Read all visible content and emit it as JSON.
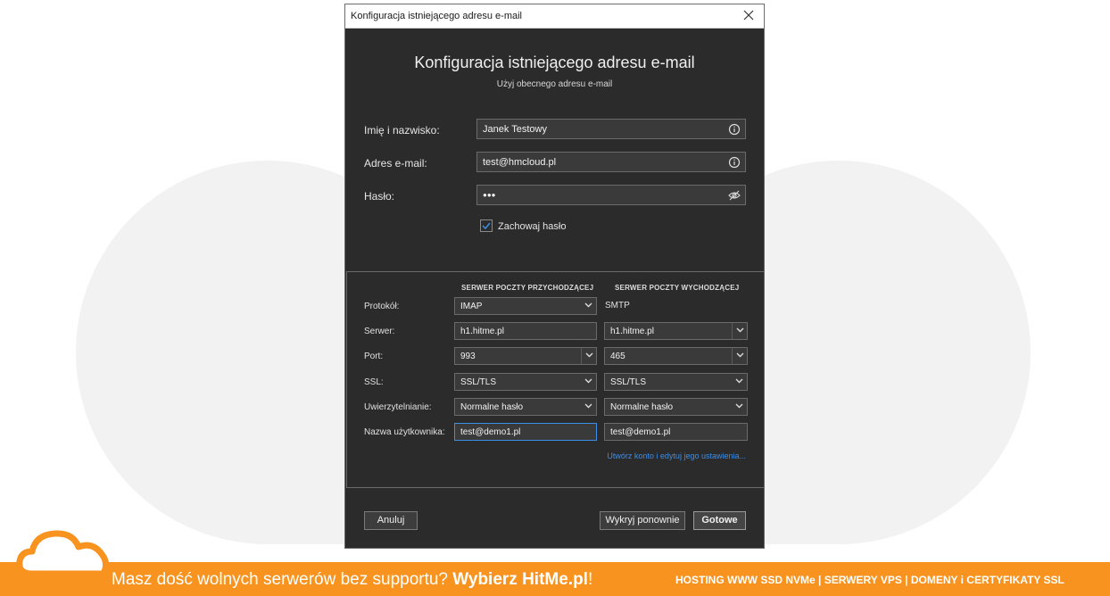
{
  "window": {
    "title": "Konfiguracja istniejącego adresu e-mail"
  },
  "header": {
    "title": "Konfiguracja istniejącego adresu e-mail",
    "subtitle": "Użyj obecnego adresu e-mail"
  },
  "form": {
    "name_label": "Imię i nazwisko:",
    "name_value": "Janek Testowy",
    "email_label": "Adres e-mail:",
    "email_value": "test@hmcloud.pl",
    "password_label": "Hasło:",
    "password_value": "●●●",
    "remember_label": "Zachowaj hasło",
    "remember_checked": true
  },
  "servers": {
    "incoming_header": "SERWER POCZTY PRZYCHODZĄCEJ",
    "outgoing_header": "SERWER POCZTY WYCHODZĄCEJ",
    "protocol_label": "Protokół:",
    "incoming_protocol": "IMAP",
    "outgoing_protocol": "SMTP",
    "server_label": "Serwer:",
    "incoming_server": "h1.hitme.pl",
    "outgoing_server": "h1.hitme.pl",
    "port_label": "Port:",
    "incoming_port": "993",
    "outgoing_port": "465",
    "ssl_label": "SSL:",
    "incoming_ssl": "SSL/TLS",
    "outgoing_ssl": "SSL/TLS",
    "auth_label": "Uwierzytelnianie:",
    "incoming_auth": "Normalne hasło",
    "outgoing_auth": "Normalne hasło",
    "username_label": "Nazwa użytkownika:",
    "incoming_username": "test@demo1.pl",
    "outgoing_username": "test@demo1.pl",
    "advanced_link": "Utwórz konto i edytuj jego ustawienia..."
  },
  "buttons": {
    "cancel": "Anuluj",
    "retest": "Wykryj ponownie",
    "done": "Gotowe"
  },
  "banner": {
    "slogan_prefix": "Masz dość wolnych serwerów bez supportu? ",
    "slogan_brand": "Wybierz HitMe.pl",
    "slogan_suffix": "!",
    "services": "HOSTING WWW SSD NVMe | SERWERY VPS | DOMENY i CERTYFIKATY SSL"
  },
  "colors": {
    "dialog_bg": "#2b2b2b",
    "accent_blue": "#3d8ee6",
    "banner_orange": "#f7931e",
    "cloud_grey": "#f2f2f2"
  },
  "icons": [
    "close-icon",
    "info-icon",
    "eye-off-icon",
    "check-icon",
    "chevron-down-icon",
    "cloud-logo-icon"
  ]
}
